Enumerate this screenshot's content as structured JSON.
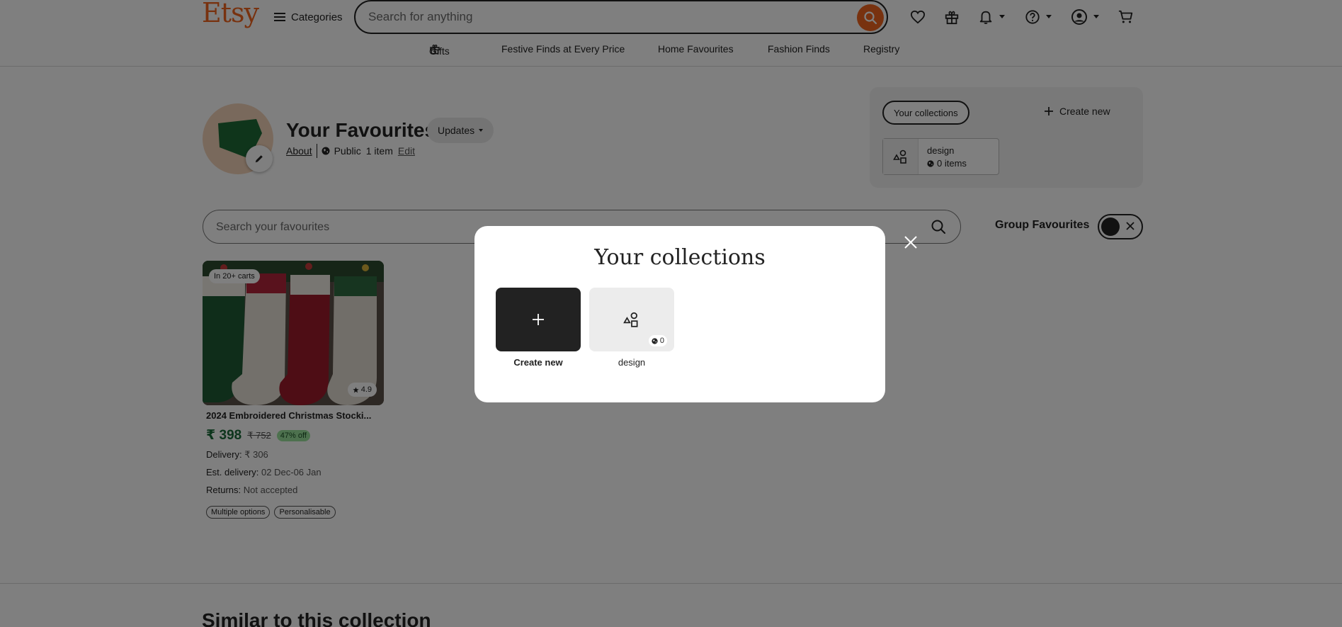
{
  "header": {
    "logo": "Etsy",
    "categories_label": "Categories",
    "search_placeholder": "Search for anything"
  },
  "subnav": [
    {
      "label": "Gifts"
    },
    {
      "label": "Festive Finds at Every Price"
    },
    {
      "label": "Home Favourites"
    },
    {
      "label": "Fashion Finds"
    },
    {
      "label": "Registry"
    }
  ],
  "profile": {
    "title": "Your Favourites",
    "updates_label": "Updates",
    "about_label": "About",
    "visibility": "Public",
    "item_count": "1 item",
    "edit_label": "Edit"
  },
  "collections_panel": {
    "tab_label": "Your collections",
    "create_new_label": "Create new",
    "card": {
      "name": "design",
      "count": "0 items"
    }
  },
  "favourites_search": {
    "placeholder": "Search your favourites"
  },
  "group_favourites_label": "Group Favourites",
  "product": {
    "cart_badge": "In 20+ carts",
    "rating": "4.9",
    "title": "2024 Embroidered Christmas Stocki...",
    "price": "₹ 398",
    "original_price": "₹ 752",
    "discount": "47% off",
    "delivery_label": "Delivery:",
    "delivery_value": "₹ 306",
    "est_label": "Est. delivery:",
    "est_value": "02 Dec-06 Jan",
    "returns_label": "Returns:",
    "returns_value": "Not accepted",
    "tags": [
      "Multiple options",
      "Personalisable"
    ]
  },
  "similar_heading": "Similar to this collection",
  "modal": {
    "title": "Your collections",
    "create_label": "Create new",
    "design_label": "design",
    "design_count": "0"
  },
  "colors": {
    "brand": "#f1641e",
    "price_green": "#1a6b39",
    "discount_bg": "#9be39d"
  }
}
